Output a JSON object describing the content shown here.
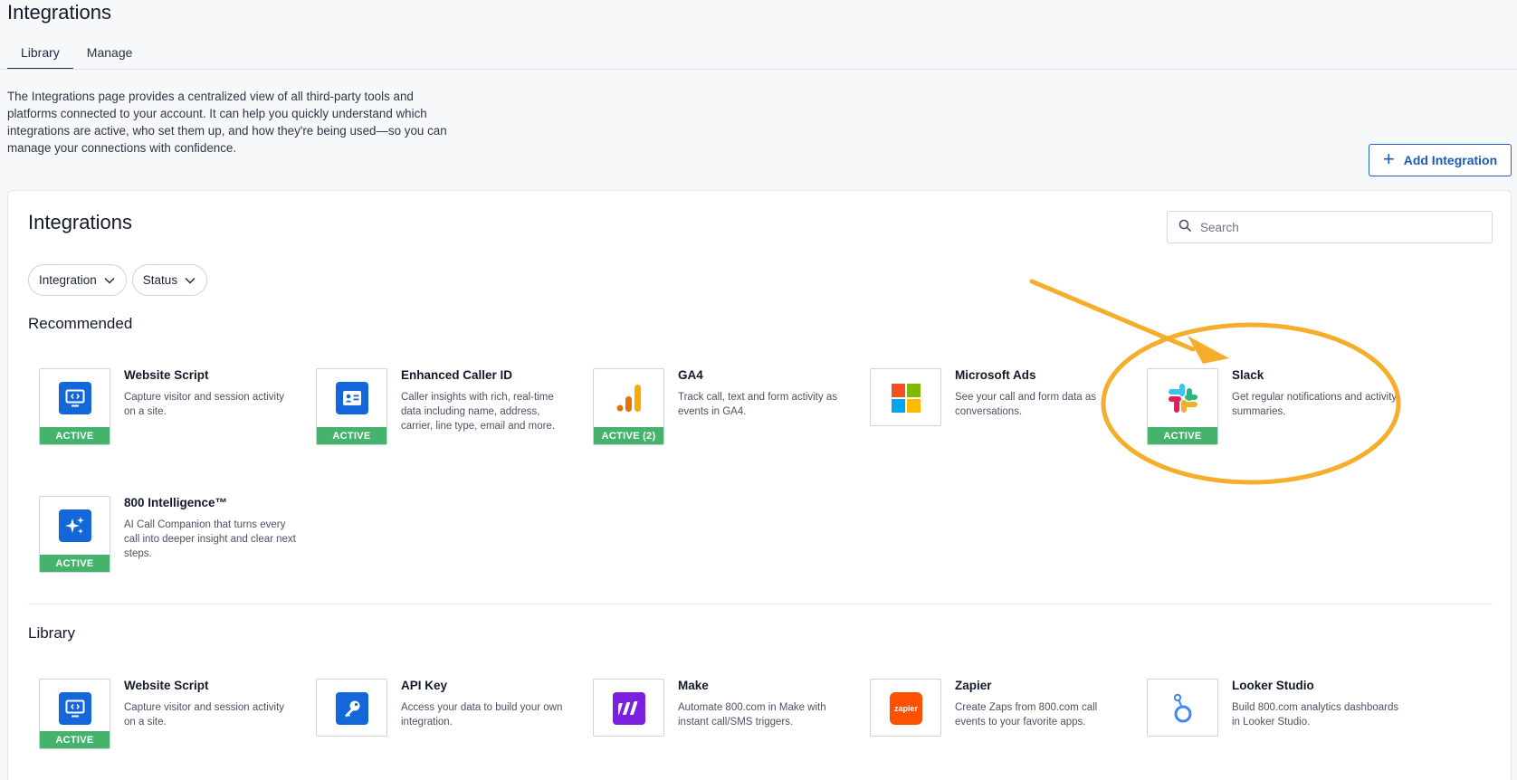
{
  "header": {
    "title": "Integrations",
    "tabs": [
      {
        "label": "Library",
        "active": true
      },
      {
        "label": "Manage",
        "active": false
      }
    ]
  },
  "intro": "The Integrations page provides a centralized view of all third-party tools and platforms connected to your account. It can help you quickly understand which integrations are active, who set them up, and how they're being used—so you can manage your connections with confidence.",
  "add_button": {
    "label": "Add Integration"
  },
  "panel": {
    "title": "Integrations",
    "search_placeholder": "Search",
    "filters": [
      "Integration",
      "Status"
    ]
  },
  "recommended": {
    "label": "Recommended",
    "cards": [
      {
        "title": "Website Script",
        "desc": "Capture visitor and session activity on a site.",
        "badge": "ACTIVE",
        "icon": "monitor-code-icon"
      },
      {
        "title": "Enhanced Caller ID",
        "desc": "Caller insights with rich, real-time data including name, address, carrier, line type, email and more.",
        "badge": "ACTIVE",
        "icon": "id-card-icon"
      },
      {
        "title": "GA4",
        "desc": "Track call, text and form activity as events in GA4.",
        "badge": "ACTIVE (2)",
        "icon": "ga4-bars-icon"
      },
      {
        "title": "Microsoft Ads",
        "desc": "See your call and form data as conversations.",
        "badge": "",
        "icon": "microsoft-logo-icon"
      },
      {
        "title": "Slack",
        "desc": "Get regular notifications and activity summaries.",
        "badge": "ACTIVE",
        "icon": "slack-logo-icon"
      },
      {
        "title": "800 Intelligence™",
        "desc": "AI Call Companion that turns every call into deeper insight and clear next steps.",
        "badge": "ACTIVE",
        "icon": "sparkle-icon"
      }
    ]
  },
  "library": {
    "label": "Library",
    "cards": [
      {
        "title": "Website Script",
        "desc": "Capture visitor and session activity on a site.",
        "badge": "ACTIVE",
        "icon": "monitor-code-icon"
      },
      {
        "title": "API Key",
        "desc": "Access your data to build your own integration.",
        "badge": "",
        "icon": "key-icon"
      },
      {
        "title": "Make",
        "desc": "Automate 800.com in Make with instant call/SMS triggers.",
        "badge": "",
        "icon": "make-logo-icon"
      },
      {
        "title": "Zapier",
        "desc": "Create Zaps from 800.com call events to your favorite apps.",
        "badge": "",
        "icon": "zapier-logo-icon",
        "logo_text": "zapier"
      },
      {
        "title": "Looker Studio",
        "desc": "Build 800.com analytics dashboards in Looker Studio.",
        "badge": "",
        "icon": "looker-logo-icon"
      }
    ]
  },
  "colors": {
    "accent_blue": "#1467d8",
    "active_green": "#45b36b",
    "annotation_orange": "#f5ae2b",
    "make_purple": "#7b1fe0",
    "zapier_orange": "#ff4f00"
  }
}
